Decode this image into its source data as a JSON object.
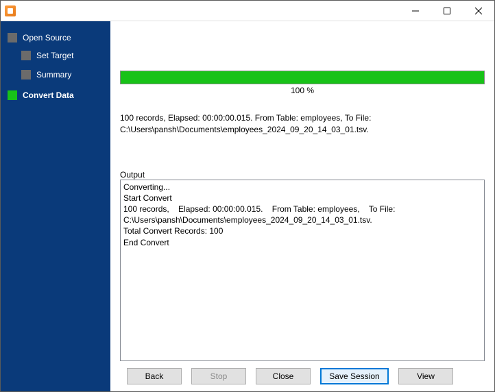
{
  "sidebar": {
    "items": [
      {
        "label": "Open Source",
        "active": false,
        "indent": 0
      },
      {
        "label": "Set Target",
        "active": false,
        "indent": 1
      },
      {
        "label": "Summary",
        "active": false,
        "indent": 1
      },
      {
        "label": "Convert Data",
        "active": true,
        "indent": 0
      }
    ]
  },
  "progress": {
    "percent_label": "100 %"
  },
  "status": {
    "line1": "100 records,    Elapsed: 00:00:00.015.    From Table: employees,    To File:",
    "line2": "C:\\Users\\pansh\\Documents\\employees_2024_09_20_14_03_01.tsv."
  },
  "output": {
    "label": "Output",
    "text": "Converting...\nStart Convert\n100 records,    Elapsed: 00:00:00.015.    From Table: employees,    To File: C:\\Users\\pansh\\Documents\\employees_2024_09_20_14_03_01.tsv.\nTotal Convert Records: 100\nEnd Convert"
  },
  "buttons": {
    "back": "Back",
    "stop": "Stop",
    "close": "Close",
    "save_session": "Save Session",
    "view": "View"
  }
}
